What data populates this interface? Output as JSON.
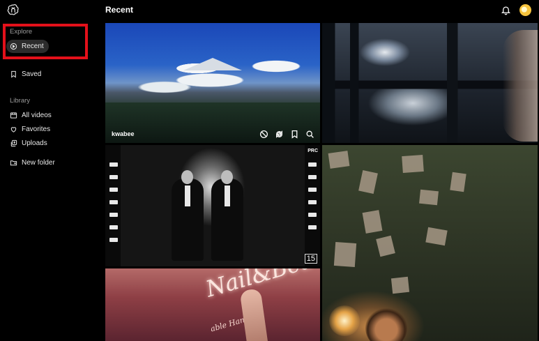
{
  "app": {
    "title": "Recent"
  },
  "sidebar": {
    "explore_label": "Explore",
    "items": [
      {
        "label": "Recent",
        "icon": "play-circle-icon",
        "active": true
      },
      {
        "label": "Saved",
        "icon": "bookmark-icon"
      }
    ],
    "library_label": "Library",
    "library_items": [
      {
        "label": "All videos",
        "icon": "video-library-icon"
      },
      {
        "label": "Favorites",
        "icon": "heart-icon"
      },
      {
        "label": "Uploads",
        "icon": "uploads-icon"
      }
    ],
    "new_folder_label": "New folder"
  },
  "header": {
    "notifications_icon": "bell-icon",
    "avatar": "user-avatar"
  },
  "videos": [
    {
      "caption": "kwabee",
      "actions": [
        "block-icon",
        "remix-icon",
        "bookmark-icon",
        "search-icon"
      ]
    },
    {
      "caption": ""
    },
    {
      "badge": "PRC",
      "frame_number": "15"
    },
    {
      "caption": ""
    },
    {
      "sign_text": "Nail&Beauty",
      "sign_subtext": "able Hands"
    }
  ],
  "colors": {
    "background": "#000000",
    "active_nav": "#2c2c2c",
    "highlight": "#e3101a"
  }
}
